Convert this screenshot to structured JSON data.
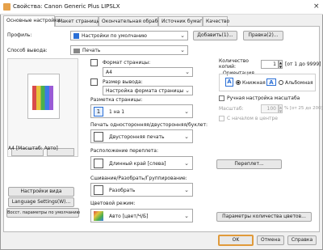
{
  "window": {
    "title": "Свойства: Canon Generic Plus LIPSLX",
    "close": "×"
  },
  "tabs": [
    "Основные настройки",
    "Макет страницы",
    "Окончательная обработка",
    "Источник бумаги",
    "Качество"
  ],
  "profile": {
    "label": "Профиль:",
    "value": "Настройки по умолчанию",
    "add": "Добавить(1)...",
    "edit": "Правка(2)..."
  },
  "output": {
    "label": "Способ вывода:",
    "value": "Печать"
  },
  "preview": {
    "caption": "A4 [Масштаб: Авто]"
  },
  "left_buttons": {
    "view": "Настройки вида",
    "language": "Language Settings(W)...",
    "restore": "Восст. параметры по умолчанию"
  },
  "paper_format": {
    "label": "Формат страницы:",
    "value": "A4"
  },
  "output_size": {
    "label": "Размер вывода:",
    "value": "Настройка формата страницы"
  },
  "layout": {
    "label": "Разметка страницы:",
    "value": "1 на 1"
  },
  "duplex": {
    "label": "Печать односторонняя/двусторонняя/буклет:",
    "value": "Двусторонняя печать"
  },
  "binding": {
    "label": "Расположение переплета:",
    "value": "Длинный край [слева]",
    "button": "Переплет..."
  },
  "stapling": {
    "label": "Сшивание/Разобрать/Группирование:",
    "value": "Разобрать"
  },
  "color_mode": {
    "label": "Цветовой режим:",
    "value": "Авто [цвет/Ч/Б]",
    "button": "Параметры количества цветов..."
  },
  "copies": {
    "label": "Количество копий:",
    "value": "1",
    "range": "[от 1 до 9999]"
  },
  "orientation": {
    "label": "Ориентация",
    "portrait": "Книжная",
    "landscape": "Альбомная"
  },
  "scaling": {
    "manual_label": "Ручная настройка масштаба",
    "label": "Масштаб:",
    "value": "100",
    "range": "% [от 25 до 200]",
    "center": "С началом в центре"
  },
  "footer": {
    "ok": "OK",
    "cancel": "Отмена",
    "help": "Справка"
  },
  "colors": {
    "accent": "#2a6fd6",
    "ok_border": "#e09a3a"
  }
}
